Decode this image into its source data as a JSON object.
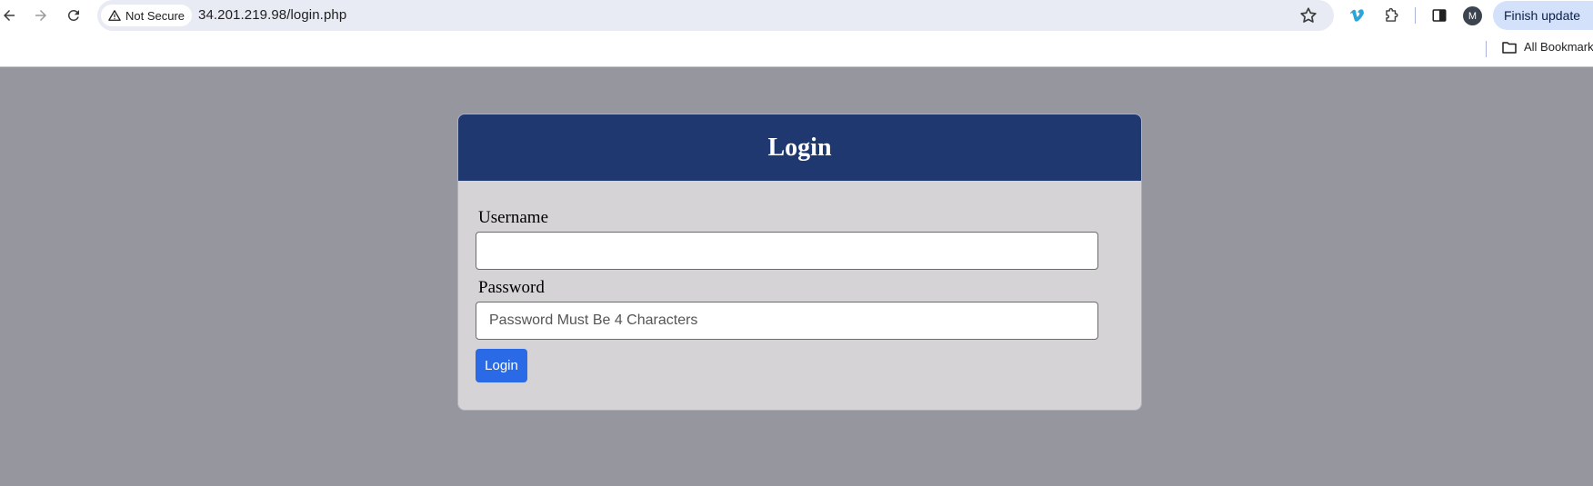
{
  "browser": {
    "security_label": "Not Secure",
    "url": "34.201.219.98/login.php",
    "profile_initial": "M",
    "update_button": "Finish update",
    "bookmarks_folder": "All Bookmarks",
    "icons": [
      "back-icon",
      "forward-icon",
      "reload-icon",
      "warning-icon",
      "star-icon",
      "vimeo-icon",
      "puzzle-icon",
      "side-panel-icon",
      "kebab-menu-icon",
      "folder-icon"
    ]
  },
  "login": {
    "title": "Login",
    "username_label": "Username",
    "username_value": "",
    "password_label": "Password",
    "password_placeholder": "Password Must Be 4 Characters",
    "submit_label": "Login"
  },
  "colors": {
    "page_background": "#96969f",
    "header_background": "#203870",
    "card_background": "#d5d3d5",
    "button_background": "#2b6ae6"
  }
}
